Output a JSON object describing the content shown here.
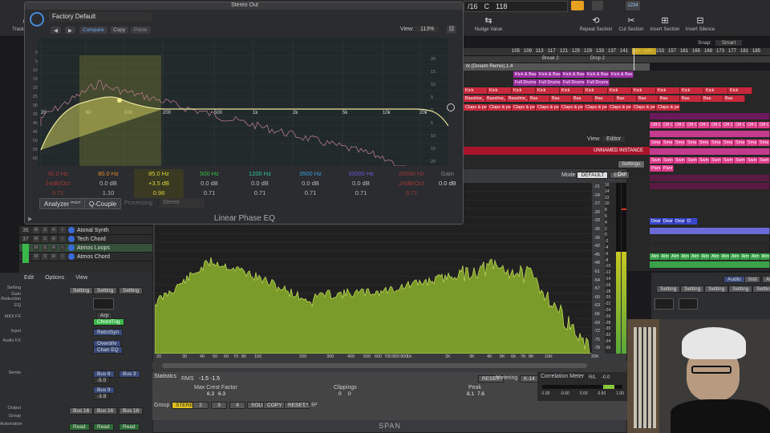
{
  "topbar": {
    "lcd_bar": "/16",
    "lcd_key": "C",
    "lcd_sig": "118",
    "tools": [
      {
        "label": "Track Zoom",
        "icon": "zoom-icon"
      },
      {
        "label": "Nudge Value",
        "icon": "nudge-icon"
      },
      {
        "label": "Repeat Section",
        "icon": "repeat-icon"
      },
      {
        "label": "Cut Section",
        "icon": "cut-icon"
      },
      {
        "label": "Insert Section",
        "icon": "insert-icon"
      },
      {
        "label": "Insert Silence",
        "icon": "silence-icon"
      }
    ],
    "snap_label": "Snap:",
    "snap_value": "Smart"
  },
  "ruler": {
    "bars": [
      "105",
      "109",
      "113",
      "117",
      "121",
      "125",
      "129",
      "133",
      "137",
      "141",
      "145",
      "149",
      "153",
      "157",
      "161",
      "165",
      "169",
      "173",
      "177",
      "181",
      "185"
    ],
    "markers": [
      "Break 2",
      "Drop 2"
    ],
    "track_label": "rk (Dosem Remix).1.4"
  },
  "arrange": {
    "row1": [
      "Kick & Bas",
      "Kick & Bas",
      "Kick & Bas",
      "Kick & Bas",
      "Kick & Bass"
    ],
    "row2": [
      "Full Drums",
      "Full Drums",
      "Full Drums",
      "Full Drums"
    ],
    "row3": [
      "Kick",
      "Kick",
      "Kick",
      "Kick",
      "Kick",
      "Kick",
      "Kick",
      "Kick",
      "Kick",
      "Kick",
      "Kick",
      "Kick"
    ],
    "row4": [
      "Bassline_b",
      "Bassline_b",
      "Bassline_b",
      "Bas",
      "Bas",
      "Bas",
      "Bas",
      "Bas",
      "Bas",
      "Bas",
      "Bas",
      "Bas",
      "Bas"
    ],
    "row5": [
      "Claps & pe",
      "Claps & pe",
      "Claps & pe",
      "Claps & pe",
      "Claps & pe",
      "Claps & pe",
      "Claps & pe",
      "Claps & pe",
      "Claps & pe"
    ],
    "row6": [
      "Off C",
      "Off C",
      "Off C",
      "Off C",
      "Off C",
      "Off C",
      "Off C",
      "Off C",
      "Off C",
      "Off C",
      "Off C"
    ],
    "row7": [
      "Sma",
      "Sma",
      "Sma",
      "Sma",
      "Sma",
      "Sma",
      "Sma",
      "Sma",
      "Sma",
      "Sma"
    ],
    "row8": [
      "Swin",
      "Swin",
      "Swin",
      "Swin",
      "Swin",
      "Swin",
      "Swin",
      "Swin",
      "Swin",
      "Swin"
    ],
    "row9": [
      "Panr",
      "Panr"
    ],
    "row10": [
      "Dear",
      "Dear",
      "Dear",
      "D"
    ],
    "row11": [
      "Atmo",
      "Atmo",
      "Atmo",
      "Atmo",
      "Atmo",
      "Atmo",
      "Atmo",
      "Atmo",
      "Atmo",
      "Atmo",
      "Atmo",
      "Atmo"
    ],
    "unnamed": "UNNAMED INSTANCE",
    "view_label": "View:",
    "view_value": "Editor"
  },
  "eq": {
    "window_title": "Stereo Out",
    "preset": "Factory Default",
    "compare": "Compare",
    "copy": "Copy",
    "paste": "Paste",
    "view_label": "View:",
    "view_value": "113%",
    "freq_labels": [
      "20",
      "50",
      "100",
      "200",
      "500",
      "1k",
      "2k",
      "5k",
      "10k",
      "20k"
    ],
    "db_labels": [
      "0",
      "5",
      "10",
      "15",
      "20",
      "25",
      "30",
      "35",
      "40",
      "45",
      "50",
      "55",
      "60"
    ],
    "right_db_labels": [
      "20",
      "15",
      "10",
      "5",
      "0",
      "5",
      "10",
      "15",
      "20"
    ],
    "bands": [
      {
        "freq": "30.0 Hz",
        "gain": "24dB/Oct",
        "q": "0.71",
        "color": "#d83434"
      },
      {
        "freq": "80.0 Hz",
        "gain": "0.0 dB",
        "q": "1.10",
        "color": "#e08a2a"
      },
      {
        "freq": "85.0 Hz",
        "gain": "+3.5 dB",
        "q": "0.98",
        "color": "#d6cf3a"
      },
      {
        "freq": "500 Hz",
        "gain": "0.0 dB",
        "q": "0.71",
        "color": "#3ac24a"
      },
      {
        "freq": "1200 Hz",
        "gain": "0.0 dB",
        "q": "0.71",
        "color": "#2fc29a"
      },
      {
        "freq": "3500 Hz",
        "gain": "0.0 dB",
        "q": "0.71",
        "color": "#3aa0d8"
      },
      {
        "freq": "10000 Hz",
        "gain": "0.0 dB",
        "q": "0.71",
        "color": "#6a5ad8"
      },
      {
        "freq": "20000 Hz",
        "gain": "24dB/Oct",
        "q": "0.71",
        "color": "#d8348a"
      }
    ],
    "gain_label": "Gain",
    "gain_value": "0.0 dB",
    "analyzer": "Analyzer",
    "analyzer_post": "POST",
    "qcouple": "Q-Couple",
    "processing_label": "Processing:",
    "processing_value": "Stereo",
    "plugin_name": "Linear Phase EQ"
  },
  "tracks": [
    {
      "num": "36",
      "name": "Atonal Synth",
      "color": "#3a6ad8"
    },
    {
      "num": "37",
      "name": "Tech Chord",
      "color": "#3a6ad8"
    },
    {
      "num": "38",
      "name": "Atmos Loops",
      "color": "#3ab84a"
    },
    {
      "num": "39",
      "name": "Atmos Chord",
      "color": "#3ab84a"
    }
  ],
  "mixer": {
    "edit": "Edit",
    "options": "Options",
    "view": "View",
    "labels": [
      "Setting",
      "Gain Reduction",
      "EQ",
      "MIDI FX",
      "Input",
      "Audio FX",
      "Sends",
      "Output",
      "Group",
      "Automation"
    ],
    "setting": "Setting",
    "arp": "Arp",
    "chordtrig": "ChordTrig",
    "retrosyn": "RetroSyn",
    "overdrive": "Overdriv",
    "chan_eq": "Chan EQ",
    "bus6": "Bus 6",
    "bus3": "Bus 3",
    "bus9": "Bus 9",
    "bus16": "Bus 16",
    "read": "Read",
    "sends_vals": [
      "-5.0",
      "-3.8"
    ],
    "input": "Input",
    "audio_fx": "Audio FX"
  },
  "span": {
    "mode_label": "Mode",
    "mode_value": "DEFAULT",
    "edit": "EDIT",
    "out_label": "Out",
    "settings": "Settings",
    "freq_labels": [
      "20",
      "30",
      "40",
      "50",
      "60",
      "70",
      "80",
      "100",
      "200",
      "300",
      "400",
      "500",
      "600",
      "700",
      "800",
      "900",
      "1K",
      "2K",
      "3K",
      "4K",
      "5K",
      "6K",
      "7K",
      "8K",
      "10K",
      "20K"
    ],
    "db_labels": [
      "-21",
      "-24",
      "-27",
      "-30",
      "-33",
      "-36",
      "-39",
      "-42",
      "-45",
      "-48",
      "-51",
      "-54",
      "-57",
      "-60",
      "-63",
      "-66",
      "-69",
      "-72",
      "-75",
      "-78"
    ],
    "meter_labels": [
      "16",
      "14",
      "12",
      "10",
      "8",
      "6",
      "4",
      "2",
      "0",
      "-2",
      "-4",
      "-6",
      "-8",
      "-10",
      "-12",
      "-14",
      "-16",
      "-18",
      "-20",
      "-22",
      "-24",
      "-26",
      "-28",
      "-30",
      "-32",
      "-34",
      "-36"
    ],
    "statistics": "Statistics",
    "rms_label": "RMS",
    "rms_l": "-1.5",
    "rms_r": "-1.5",
    "crest_label": "Max Crest Factor",
    "crest_l": "6.3",
    "crest_r": "6.3",
    "clippings_label": "Clippings",
    "clip_l": "0",
    "clip_r": "0",
    "peak_label": "Peak",
    "peak_l": "8.1",
    "peak_r": "7.6",
    "reset": "RESET",
    "metering": "Metering",
    "metering_value": "K-14",
    "correlation": "Correlation Meter",
    "corr_mode": "R/L",
    "corr_val": "-0.0",
    "corr_scale": [
      "-1.00",
      "-0.50",
      "0.00",
      "0.50",
      "1.00"
    ],
    "group": "Group",
    "group_btns": [
      "STEREO",
      "2",
      "3",
      "4"
    ],
    "solo": "SOLO",
    "copy_to": "COPY TO",
    "reset2": "RESET",
    "lr": "L², R²",
    "name": "SPAN"
  },
  "right_panel": {
    "audio": "Audio",
    "inst": "Inst",
    "all": "All",
    "setting": "Setting"
  }
}
